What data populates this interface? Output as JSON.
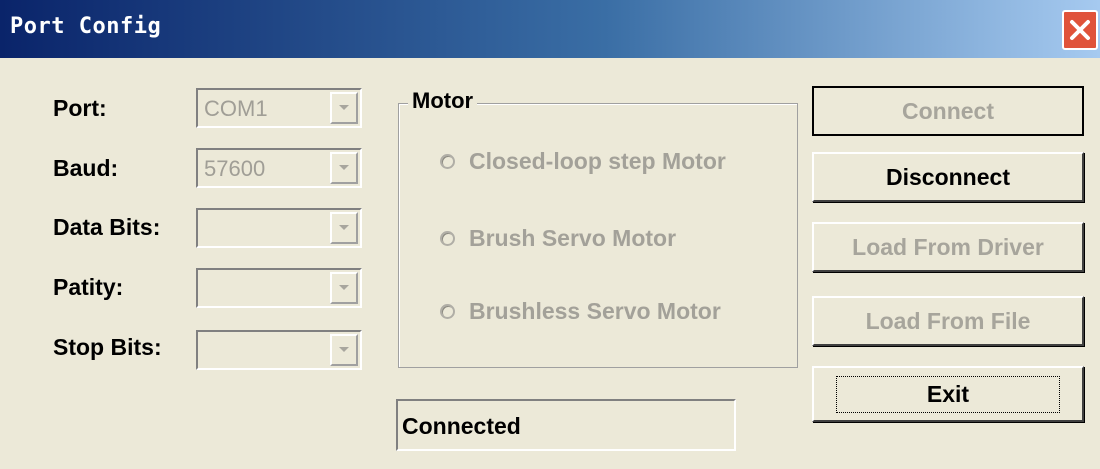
{
  "window": {
    "title": "Port Config"
  },
  "settings": {
    "fields": [
      {
        "label": "Port:",
        "value": "COM1"
      },
      {
        "label": "Baud:",
        "value": "57600"
      },
      {
        "label": "Data Bits:",
        "value": ""
      },
      {
        "label": "Patity:",
        "value": ""
      },
      {
        "label": "Stop Bits:",
        "value": ""
      }
    ]
  },
  "motor": {
    "group_label": "Motor",
    "options": [
      "Closed-loop step Motor",
      "Brush Servo Motor",
      "Brushless Servo Motor"
    ]
  },
  "buttons": {
    "connect": "Connect",
    "disconnect": "Disconnect",
    "load_driver": "Load From Driver",
    "load_file": "Load From File",
    "exit": "Exit"
  },
  "status": {
    "text": "Connected"
  },
  "icons": {
    "close": "close-icon",
    "dropdown": "chevron-down-icon",
    "radio": "radio-icon"
  }
}
